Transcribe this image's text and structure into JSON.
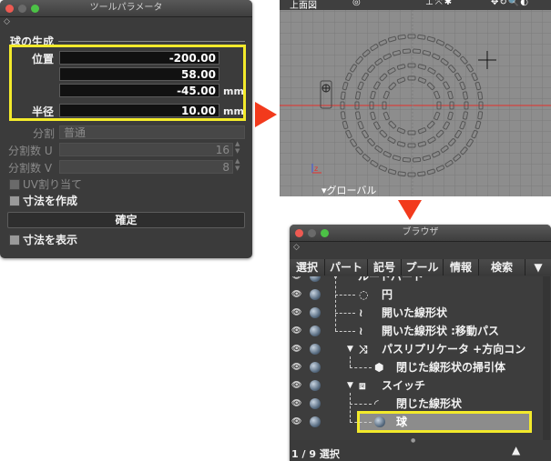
{
  "tool_panel": {
    "title": "ツールパラメータ",
    "section": "球の生成",
    "position_label": "位置",
    "position": [
      "-200.00",
      "58.00",
      "-45.00"
    ],
    "radius_label": "半径",
    "radius": "10.00",
    "unit": "mm",
    "division_label": "分割",
    "division_value": "普通",
    "div_u_label": "分割数 U",
    "div_u_value": "16",
    "div_v_label": "分割数 V",
    "div_v_value": "8",
    "uv_label": "UV割り当て",
    "create_dim_label": "寸法を作成",
    "confirm_button": "確定",
    "show_dim_label": "寸法を表示",
    "highlight_color": "#f3ea2b"
  },
  "viewport": {
    "view_label": "上面図",
    "global_label": "▾グローバル",
    "grid_color": "#7a7a7a",
    "axis_color": "#e8302a"
  },
  "browser": {
    "title": "ブラウザ",
    "tabs": [
      "選択",
      "パート",
      "記号",
      "プール",
      "情報",
      "検索"
    ],
    "tree": [
      {
        "label": "ルートパート"
      },
      {
        "label": "円"
      },
      {
        "label": "開いた線形状"
      },
      {
        "label": "開いた線形状 :移動パス"
      },
      {
        "label": "パスリプリケータ +方向コン"
      },
      {
        "label": "閉じた線形状の掃引体"
      },
      {
        "label": "スイッチ"
      },
      {
        "label": "閉じた線形状"
      },
      {
        "label": "球"
      }
    ],
    "status": "1 / 9 選択",
    "selected_color": "#8c8c8c"
  },
  "arrow_color": "#f23a1c"
}
